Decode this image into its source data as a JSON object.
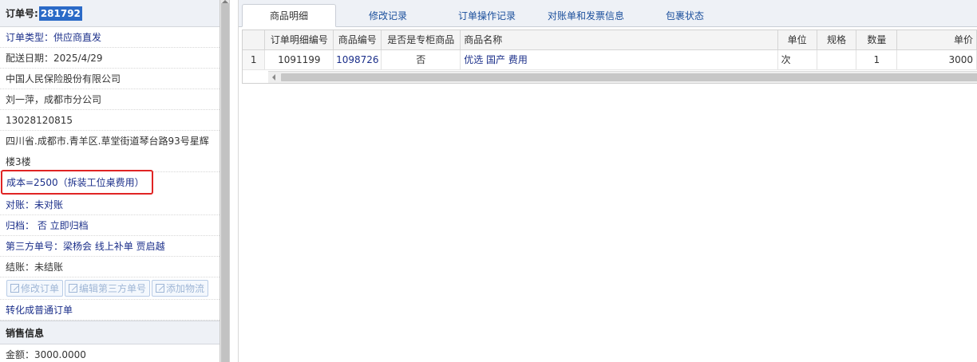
{
  "order": {
    "number_label": "订单号:",
    "number_value": "281792",
    "type": "订单类型：供应商直发",
    "delivery_date": "配送日期：2025/4/29",
    "company": "中国人民保险股份有限公司",
    "contact": "刘一萍，成都市分公司",
    "phone": "13028120815",
    "address_line1": "四川省.成都市.青羊区.草堂街道琴台路93号星辉",
    "address_line2": "楼3楼",
    "cost": "成本=2500（拆装工位桌费用）",
    "reconcile": "对账：未对账",
    "archive": "归档：  否  立即归档",
    "third_party": "第三方单号：梁杨会 线上补单 贾启越",
    "settlement": "结账：未结账",
    "buttons": {
      "edit_order": "修改订单",
      "edit_third_party": "编辑第三方单号",
      "add_logistics": "添加物流"
    },
    "convert": "转化成普通订单",
    "sales_header": "销售信息",
    "amount": "金额：3000.0000"
  },
  "tabs": [
    {
      "label": "商品明细",
      "active": true
    },
    {
      "label": "修改记录",
      "active": false
    },
    {
      "label": "订单操作记录",
      "active": false
    },
    {
      "label": "对账单和发票信息",
      "active": false
    },
    {
      "label": "包裹状态",
      "active": false
    }
  ],
  "grid": {
    "headers": [
      "订单明细编号",
      "商品编号",
      "是否是专柜商品",
      "商品名称",
      "单位",
      "规格",
      "数量",
      "单价"
    ],
    "rows": [
      {
        "num": "1",
        "detail_no": "1091199",
        "product_no": "1098726",
        "is_counter": "否",
        "name": "优选 国产 费用",
        "unit": "次",
        "spec": "",
        "qty": "1",
        "price": "3000"
      }
    ]
  },
  "colors": {
    "accent": "#2a6ac7",
    "link": "#1b2f8a",
    "highlight_border": "#e02424"
  }
}
